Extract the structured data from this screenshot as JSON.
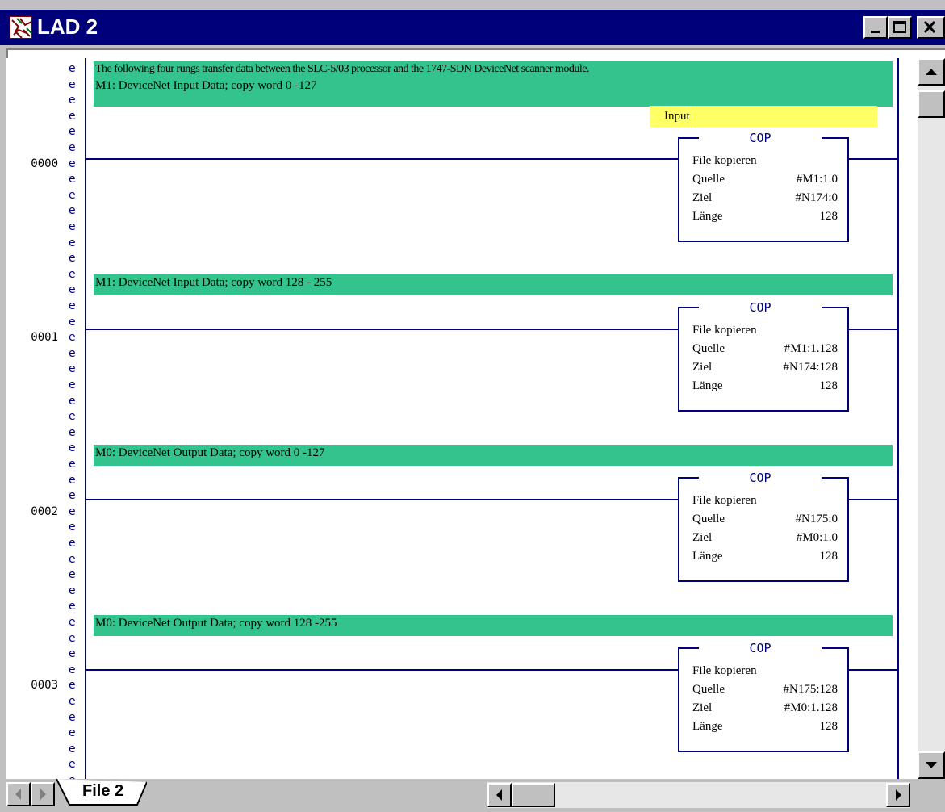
{
  "window": {
    "title": "LAD 2",
    "icon": "ladder-app-icon",
    "controls": [
      "minimize-icon",
      "maximize-icon",
      "close-icon"
    ]
  },
  "editor": {
    "row_marker": "e",
    "rungs": [
      {
        "number": "0000",
        "comment": [
          "The following four rungs transfer data between the SLC-5/03 processor and the 1747-SDN DeviceNet scanner module.",
          "M1: DeviceNet Input Data; copy word 0 -127"
        ],
        "symbol": "Input",
        "instruction": {
          "name": "COP",
          "description": "File kopieren",
          "source_label": "Quelle",
          "source": "#M1:1.0",
          "dest_label": "Ziel",
          "dest": "#N174:0",
          "length_label": "Länge",
          "length": "128"
        }
      },
      {
        "number": "0001",
        "comment": [
          "M1: DeviceNet Input Data; copy word 128 - 255"
        ],
        "instruction": {
          "name": "COP",
          "description": "File kopieren",
          "source_label": "Quelle",
          "source": "#M1:1.128",
          "dest_label": "Ziel",
          "dest": "#N174:128",
          "length_label": "Länge",
          "length": "128"
        }
      },
      {
        "number": "0002",
        "comment": [
          "M0: DeviceNet Output Data; copy word 0 -127"
        ],
        "instruction": {
          "name": "COP",
          "description": "File kopieren",
          "source_label": "Quelle",
          "source": "#N175:0",
          "dest_label": "Ziel",
          "dest": "#M0:1.0",
          "length_label": "Länge",
          "length": "128"
        }
      },
      {
        "number": "0003",
        "comment": [
          "M0: DeviceNet Output Data; copy word 128 -255"
        ],
        "instruction": {
          "name": "COP",
          "description": "File kopieren",
          "source_label": "Quelle",
          "source": "#N175:128",
          "dest_label": "Ziel",
          "dest": "#M0:1.128",
          "length_label": "Länge",
          "length": "128"
        }
      }
    ]
  },
  "tabs": [
    {
      "label": "File 2",
      "active": true
    }
  ],
  "colors": {
    "titlebar": "#00007b",
    "comment_bg": "#33c48d",
    "symbol_bg": "#ffff66",
    "rung_line": "#00007b"
  }
}
